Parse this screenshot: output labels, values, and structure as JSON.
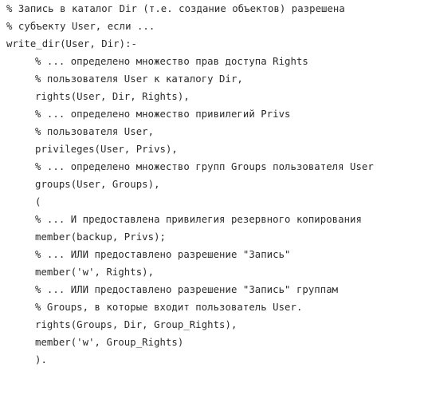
{
  "document": {
    "type": "prolog-source-listing",
    "language": "Prolog",
    "comment_prefix": "%",
    "colors": {
      "background": "#ffffff",
      "text": "#2b2b2b"
    },
    "predicate_head": "write_dir(User, Dir)",
    "lines": [
      {
        "n": 1,
        "indent": 0,
        "kind": "comment",
        "text": "% Запись в каталог Dir (т.е. создание объектов) разрешена"
      },
      {
        "n": 2,
        "indent": 0,
        "kind": "comment",
        "text": "% субъекту User, если ..."
      },
      {
        "n": 3,
        "indent": 0,
        "kind": "code",
        "text": "write_dir(User, Dir):-"
      },
      {
        "n": 4,
        "indent": 1,
        "kind": "comment",
        "text": "% ... определено множество прав доступа Rights"
      },
      {
        "n": 5,
        "indent": 1,
        "kind": "comment",
        "text": "% пользователя User к каталогу Dir,"
      },
      {
        "n": 6,
        "indent": 1,
        "kind": "code",
        "text": "rights(User, Dir, Rights),"
      },
      {
        "n": 7,
        "indent": 1,
        "kind": "comment",
        "text": "% ... определено множество привилегий Privs"
      },
      {
        "n": 8,
        "indent": 1,
        "kind": "comment",
        "text": "% пользователя User,"
      },
      {
        "n": 9,
        "indent": 1,
        "kind": "code",
        "text": "privileges(User, Privs),"
      },
      {
        "n": 10,
        "indent": 1,
        "kind": "comment",
        "text": "% ... определено множество групп Groups пользователя User"
      },
      {
        "n": 11,
        "indent": 1,
        "kind": "code",
        "text": "groups(User, Groups),"
      },
      {
        "n": 12,
        "indent": 1,
        "kind": "code",
        "text": "("
      },
      {
        "n": 13,
        "indent": 1,
        "kind": "comment",
        "text": "% ... И предоставлена привилегия резервного копирования"
      },
      {
        "n": 14,
        "indent": 1,
        "kind": "code",
        "text": "member(backup, Privs);"
      },
      {
        "n": 15,
        "indent": 1,
        "kind": "comment",
        "text": "% ... ИЛИ предоставлено разрешение \"Запись\""
      },
      {
        "n": 16,
        "indent": 1,
        "kind": "code",
        "text": "member('w', Rights),"
      },
      {
        "n": 17,
        "indent": 1,
        "kind": "comment",
        "text": "% ... ИЛИ предоставлено разрешение \"Запись\" группам"
      },
      {
        "n": 18,
        "indent": 1,
        "kind": "comment",
        "text": "% Groups, в которые входит пользователь User."
      },
      {
        "n": 19,
        "indent": 1,
        "kind": "code",
        "text": "rights(Groups, Dir, Group_Rights),"
      },
      {
        "n": 20,
        "indent": 1,
        "kind": "code",
        "text": "member('w', Group_Rights)"
      },
      {
        "n": 21,
        "indent": 1,
        "kind": "code",
        "text": ")."
      }
    ]
  }
}
